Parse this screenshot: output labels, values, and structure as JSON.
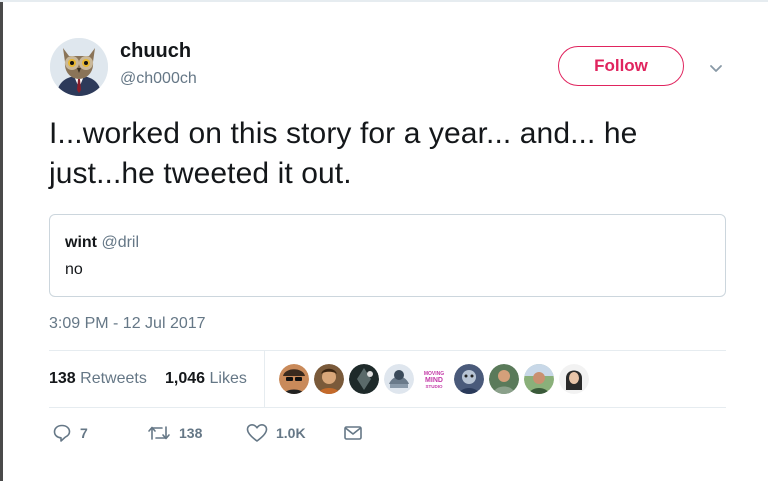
{
  "author": {
    "name": "chuuch",
    "handle": "@ch000ch",
    "avatar_icon": "owl-in-suit-avatar"
  },
  "follow_button": {
    "label": "Follow",
    "color": "#e0245e"
  },
  "menu_icon": "chevron-down-icon",
  "tweet": {
    "text": "I...worked on this story for a year... and... he just...he tweeted it out."
  },
  "quoted_tweet": {
    "name": "wint",
    "handle": "@dril",
    "text": "no"
  },
  "timestamp": "3:09 PM - 12 Jul 2017",
  "stats": {
    "retweets_count": "138",
    "retweets_label": "Retweets",
    "likes_count": "1,046",
    "likes_label": "Likes"
  },
  "liker_avatars": [
    {
      "icon": "avatar-sunglasses",
      "color": "#3a2a1e"
    },
    {
      "icon": "avatar-brown",
      "color": "#7a5a3a"
    },
    {
      "icon": "avatar-dark",
      "color": "#1e2a2a"
    },
    {
      "icon": "avatar-illustration",
      "color": "#6a7a8a"
    },
    {
      "icon": "avatar-logo",
      "color": "#c43aa8",
      "text": "MOVING MIND STUDIO"
    },
    {
      "icon": "avatar-blue",
      "color": "#4a5a7a"
    },
    {
      "icon": "avatar-green",
      "color": "#5a7a5a"
    },
    {
      "icon": "avatar-field",
      "color": "#6a8a5a"
    },
    {
      "icon": "avatar-portrait",
      "color": "#2a2a2a"
    }
  ],
  "actions": {
    "reply_count": "7",
    "retweet_count": "138",
    "like_count": "1.0K"
  },
  "colors": {
    "text": "#14171a",
    "secondary": "#657786",
    "border": "#ccd6dd",
    "divider": "#e6ecf0"
  }
}
